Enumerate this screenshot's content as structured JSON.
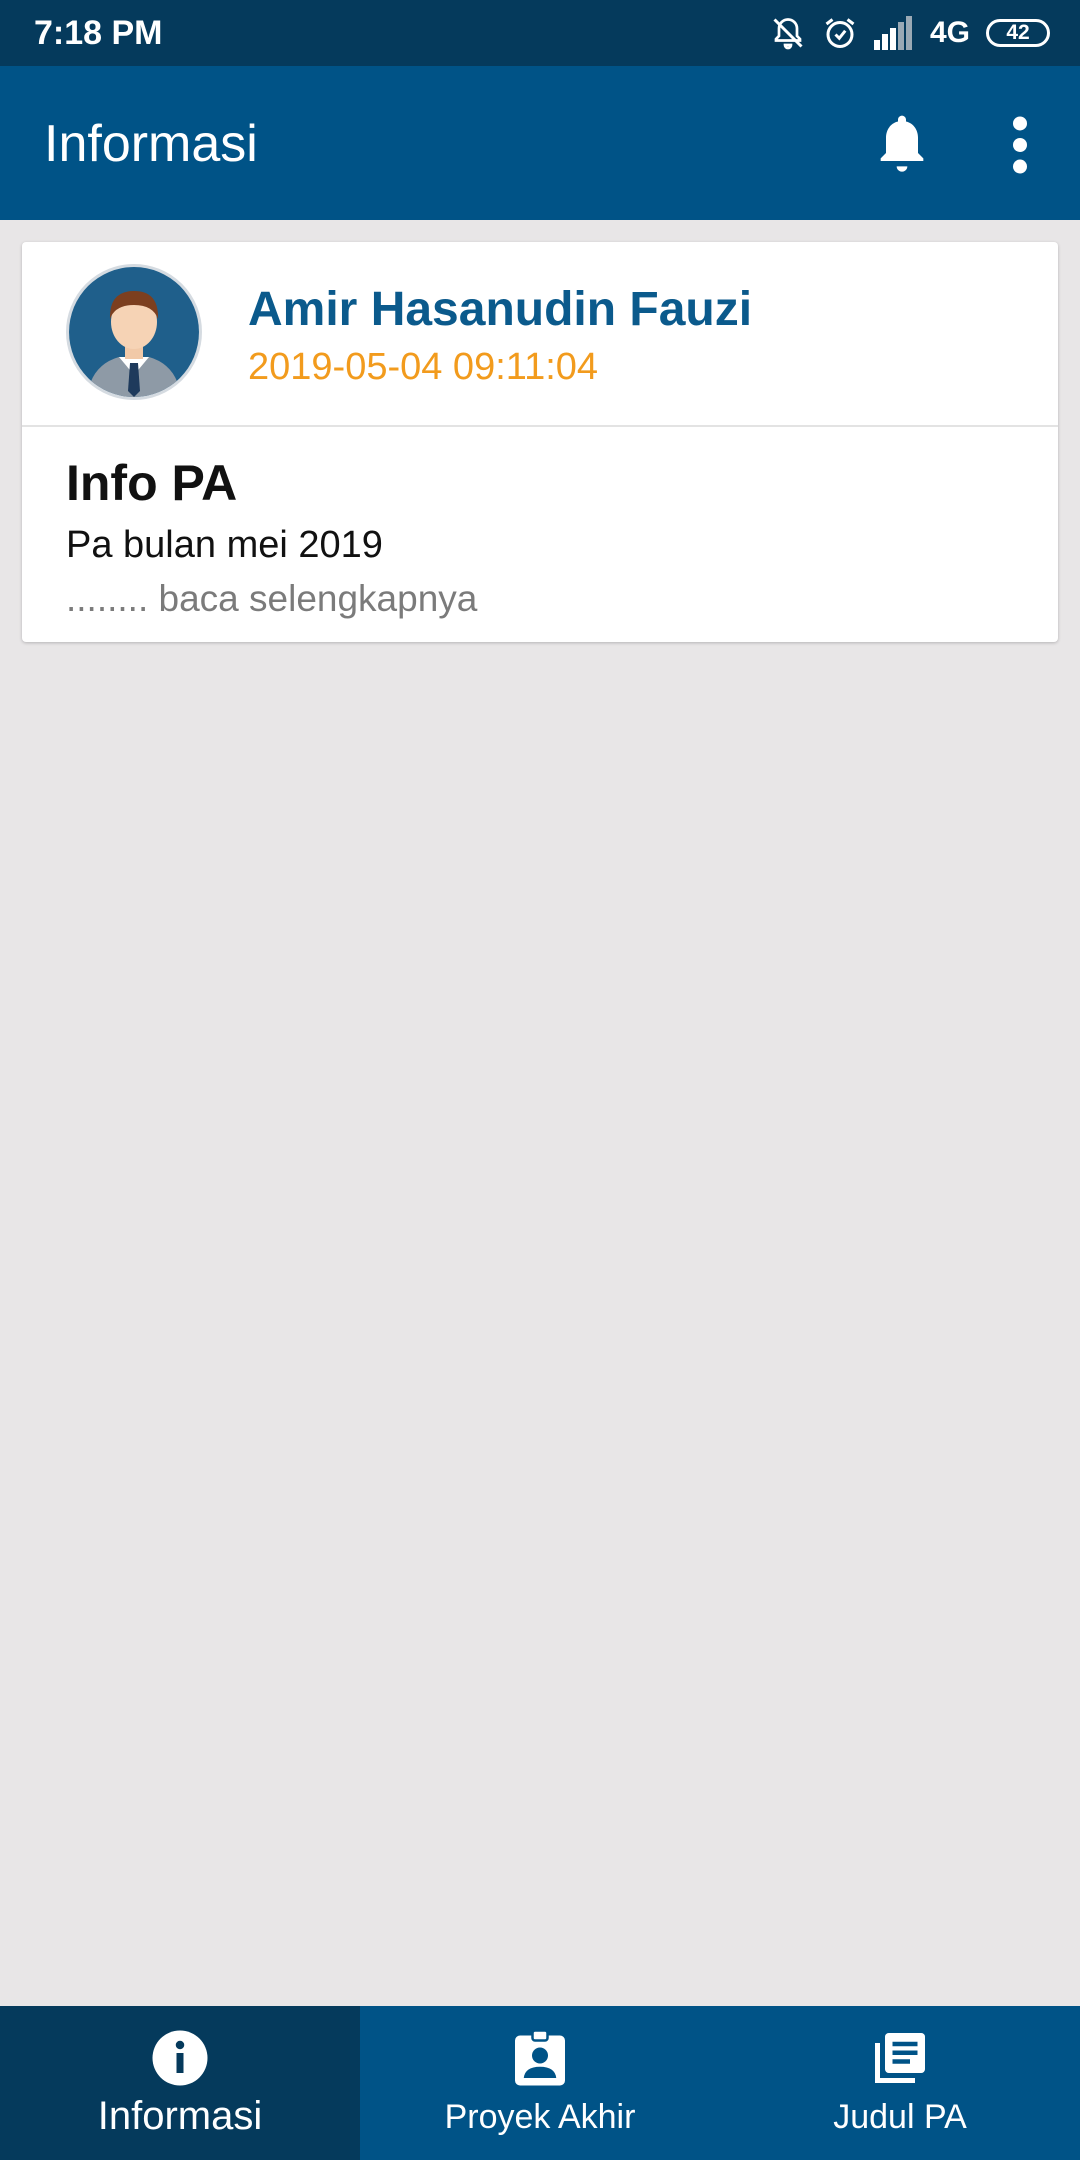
{
  "status_bar": {
    "time": "7:18 PM",
    "network": "4G",
    "battery": "42"
  },
  "app_bar": {
    "title": "Informasi",
    "icons": [
      "bell-icon",
      "more-vert-icon"
    ]
  },
  "post": {
    "author": "Amir Hasanudin Fauzi",
    "timestamp": "2019-05-04 09:11:04",
    "title": "Info PA",
    "body": "Pa bulan mei 2019",
    "read_more": "........ baca selengkapnya"
  },
  "bottom_nav": {
    "items": [
      {
        "label": "Informasi",
        "icon": "info-icon",
        "active": true
      },
      {
        "label": "Proyek Akhir",
        "icon": "assignment-ind-icon",
        "active": false
      },
      {
        "label": "Judul PA",
        "icon": "library-books-icon",
        "active": false
      }
    ]
  },
  "colors": {
    "status_bar": "#053a5c",
    "primary": "#005387",
    "author_name": "#0b5a8c",
    "timestamp": "#f29b1d",
    "background": "#e8e6e7"
  }
}
